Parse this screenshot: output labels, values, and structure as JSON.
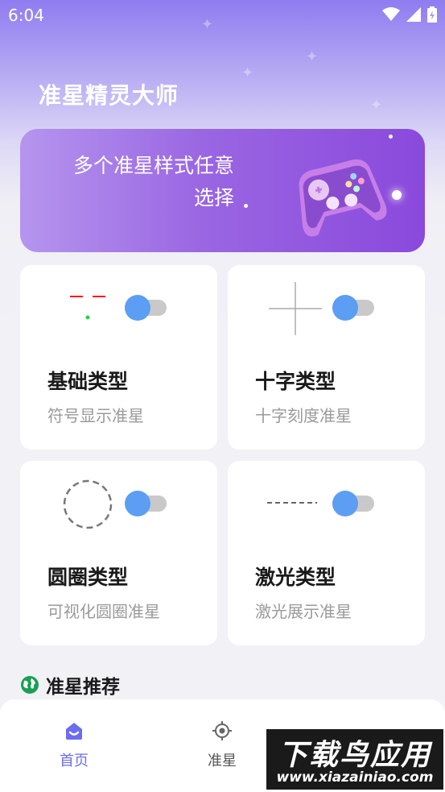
{
  "status_bar": {
    "time": "6:04"
  },
  "app_title": "准星精灵大师",
  "banner": {
    "text": "多个准星样式任意选择"
  },
  "cards": [
    {
      "title": "基础类型",
      "subtitle": "符号显示准星",
      "toggle_on": true
    },
    {
      "title": "十字类型",
      "subtitle": "十字刻度准星",
      "toggle_on": true
    },
    {
      "title": "圆圈类型",
      "subtitle": "可视化圆圈准星",
      "toggle_on": true
    },
    {
      "title": "激光类型",
      "subtitle": "激光展示准星",
      "toggle_on": true
    }
  ],
  "section": {
    "title": "准星推荐",
    "icon": "globe-icon"
  },
  "nav": {
    "items": [
      {
        "label": "首页",
        "icon": "home-icon",
        "active": true
      },
      {
        "label": "准星",
        "icon": "crosshair-icon",
        "active": false
      }
    ]
  },
  "watermark": {
    "main": "下载鸟应用",
    "sub": "www.xiazainiao.com"
  },
  "colors": {
    "accent": "#5b9ef3",
    "nav_active": "#6c6cf0",
    "banner": "#9a66e2"
  }
}
